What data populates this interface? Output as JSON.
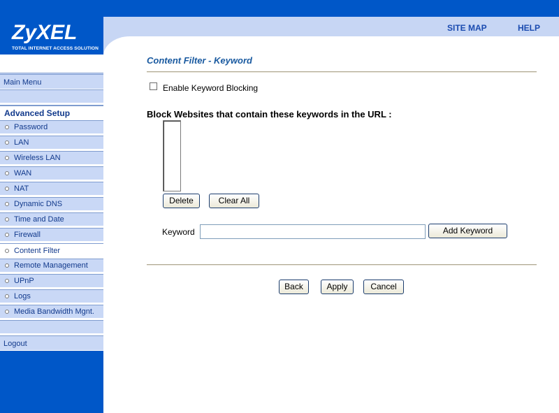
{
  "brand": {
    "logo": "ZyXEL",
    "tagline": "TOTAL INTERNET ACCESS SOLUTION"
  },
  "header": {
    "site_map": "SITE MAP",
    "help": "HELP"
  },
  "sidebar": {
    "main_menu": "Main Menu",
    "section_title": "Advanced Setup",
    "items": [
      {
        "label": "Password"
      },
      {
        "label": "LAN"
      },
      {
        "label": "Wireless LAN"
      },
      {
        "label": "WAN"
      },
      {
        "label": "NAT"
      },
      {
        "label": "Dynamic DNS"
      },
      {
        "label": "Time and Date"
      },
      {
        "label": "Firewall"
      },
      {
        "label": "Content Filter"
      },
      {
        "label": "Remote Management"
      },
      {
        "label": "UPnP"
      },
      {
        "label": "Logs"
      },
      {
        "label": "Media Bandwidth Mgnt."
      }
    ],
    "active_item": "Content Filter",
    "logout": "Logout"
  },
  "content": {
    "title": "Content Filter - Keyword",
    "enable_label": "Enable Keyword Blocking",
    "enable_checked": false,
    "block_label": "Block Websites that contain these keywords in the URL :",
    "keywords": [],
    "delete_label": "Delete",
    "clear_all_label": "Clear All",
    "keyword_label": "Keyword",
    "keyword_value": "",
    "add_keyword_label": "Add Keyword",
    "back_label": "Back",
    "apply_label": "Apply",
    "cancel_label": "Cancel"
  },
  "colors": {
    "brand_blue": "#0057c8",
    "menu_bg": "#c9d8f6",
    "title_blue": "#1a5aa0"
  }
}
